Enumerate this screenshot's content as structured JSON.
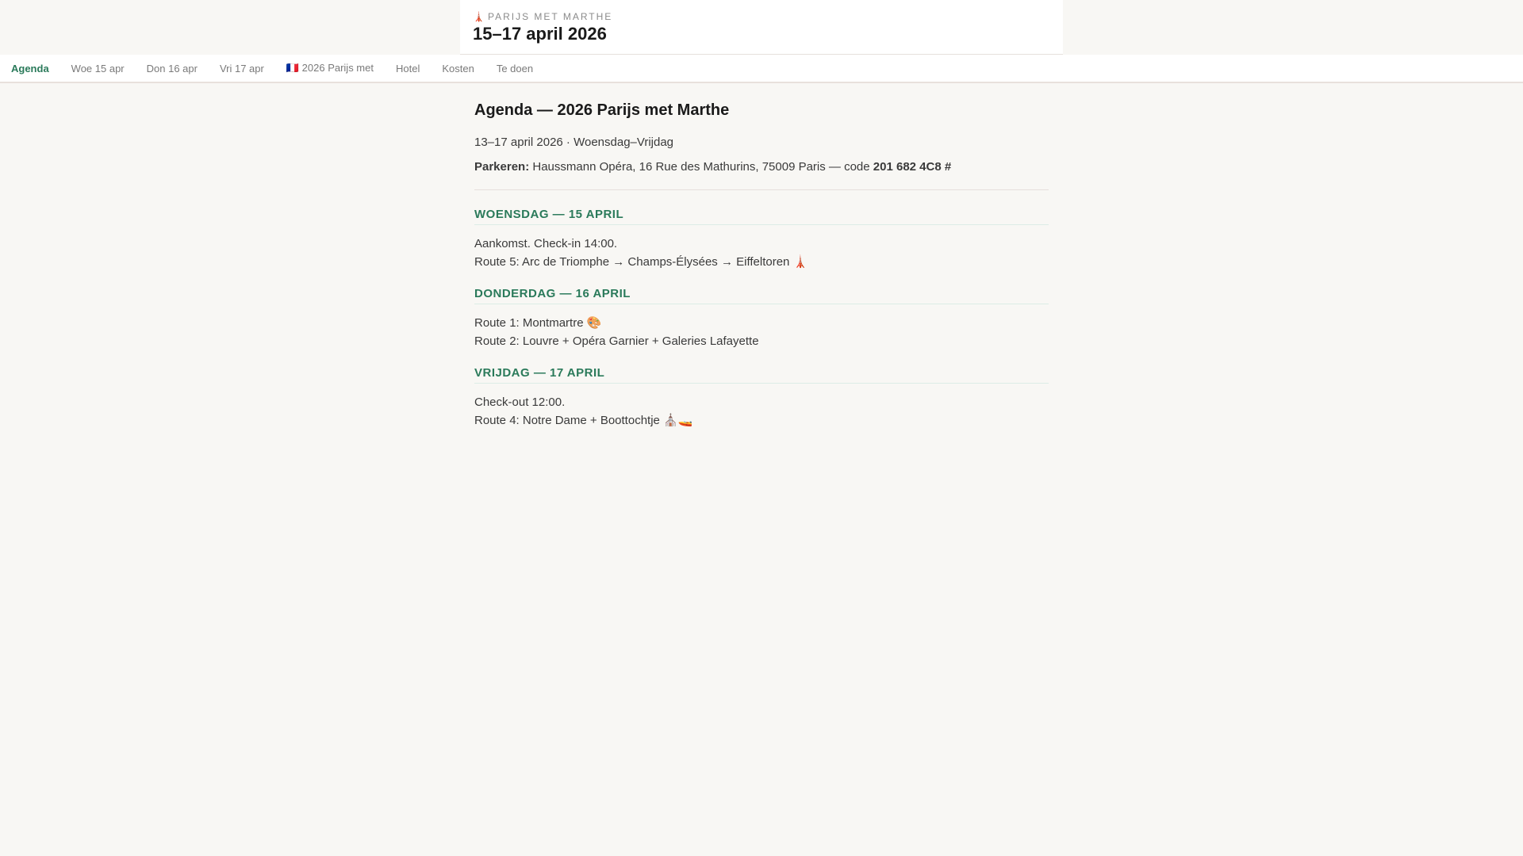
{
  "header": {
    "eyebrow_icon": "🗼",
    "eyebrow": "PARIJS MET MARTHE",
    "title": "15–17 april 2026"
  },
  "nav": [
    {
      "label": "Agenda",
      "active": true
    },
    {
      "label": "Woe 15 apr"
    },
    {
      "label": "Don 16 apr"
    },
    {
      "label": "Vri 17 apr"
    },
    {
      "label": "🇫🇷 2026 Parijs met"
    },
    {
      "label": "Hotel"
    },
    {
      "label": "Kosten"
    },
    {
      "label": "Te doen"
    }
  ],
  "main": {
    "title": "Agenda — 2026 Parijs met Marthe",
    "dates": "13–17 april 2026 · Woensdag–Vrijdag",
    "parking_label": "Parkeren:",
    "parking_text": " Haussmann Opéra, 16 Rue des Mathurins, 75009 Paris — code ",
    "parking_code": "201 682 4C8 #",
    "days": [
      {
        "heading": "WOENSDAG — 15 APRIL",
        "lines": [
          "Aankomst. Check-in 14:00.",
          "Route 5: Arc de Triomphe → Champs-Élysées → Eiffeltoren 🗼"
        ]
      },
      {
        "heading": "DONDERDAG — 16 APRIL",
        "lines": [
          "Route 1: Montmartre 🎨",
          "Route 2: Louvre + Opéra Garnier + Galeries Lafayette"
        ]
      },
      {
        "heading": "VRIJDAG — 17 APRIL",
        "lines": [
          "Check-out 12:00.",
          "Route 4: Notre Dame + Boottochtje ⛪🚤"
        ]
      }
    ]
  }
}
